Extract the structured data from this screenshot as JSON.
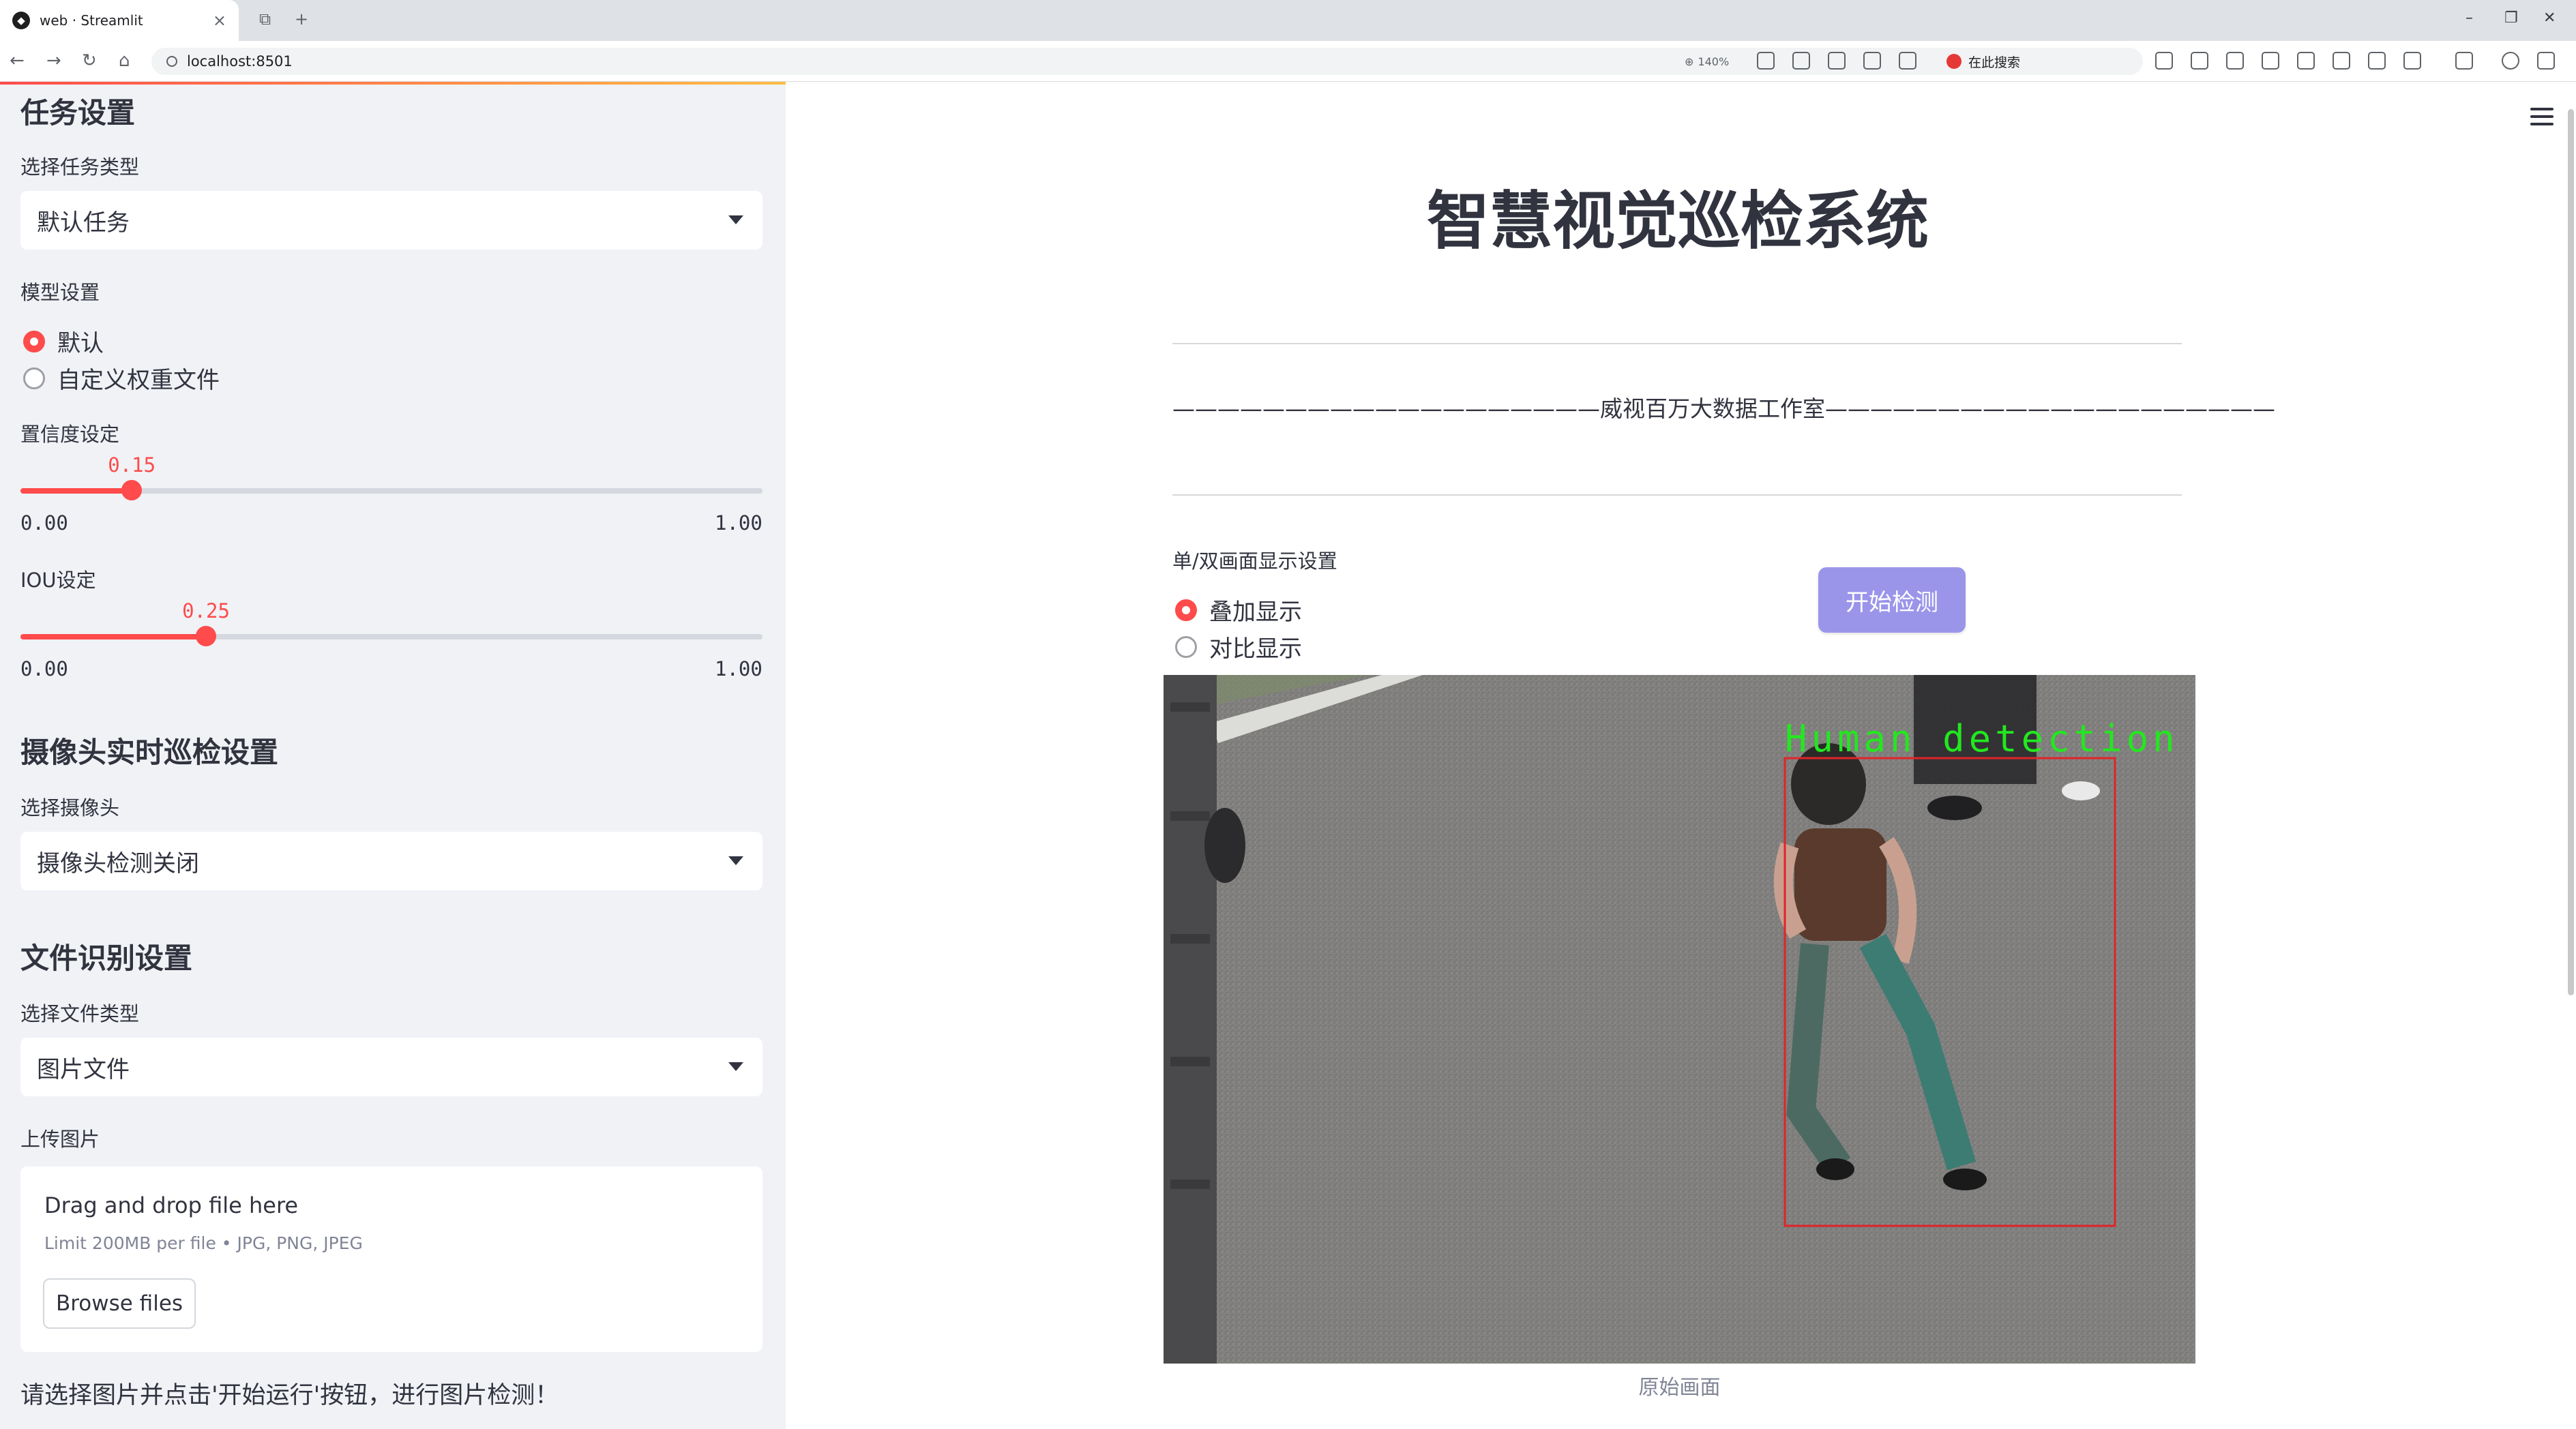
{
  "browser": {
    "tab_title": "web · Streamlit",
    "url": "localhost:8501",
    "zoom": "140%",
    "search_placeholder": "在此搜索"
  },
  "sidebar": {
    "task_section": {
      "heading": "任务设置",
      "select_label": "选择任务类型",
      "select_value": "默认任务"
    },
    "model_section": {
      "label": "模型设置",
      "options": [
        "默认",
        "自定义权重文件"
      ],
      "selected_index": 0
    },
    "confidence": {
      "label": "置信度设定",
      "value": "0.15",
      "value_fraction": 0.15,
      "min": "0.00",
      "max": "1.00"
    },
    "iou": {
      "label": "IOU设定",
      "value": "0.25",
      "value_fraction": 0.25,
      "min": "0.00",
      "max": "1.00"
    },
    "camera_section": {
      "heading": "摄像头实时巡检设置",
      "select_label": "选择摄像头",
      "select_value": "摄像头检测关闭"
    },
    "file_section": {
      "heading": "文件识别设置",
      "select_label": "选择文件类型",
      "select_value": "图片文件",
      "upload_label": "上传图片",
      "upload_title": "Drag and drop file here",
      "upload_limit": "Limit 200MB per file • JPG, PNG, JPEG",
      "browse_label": "Browse files"
    },
    "note": "请选择图片并点击'开始运行'按钮，进行图片检测！"
  },
  "main": {
    "title": "智慧视觉巡检系统",
    "subtitle": "———————————————————威视百万大数据工作室————————————————————",
    "display_label": "单/双画面显示设置",
    "display_options": [
      "叠加显示",
      "对比显示"
    ],
    "display_selected_index": 0,
    "start_button": "开始检测",
    "detection_label": "Human detection",
    "caption": "原始画面",
    "colors": {
      "accent": "#ff4b4b",
      "button": "#9b95ea",
      "detection_box": "#e0242a",
      "detection_text": "#22e81f"
    }
  }
}
